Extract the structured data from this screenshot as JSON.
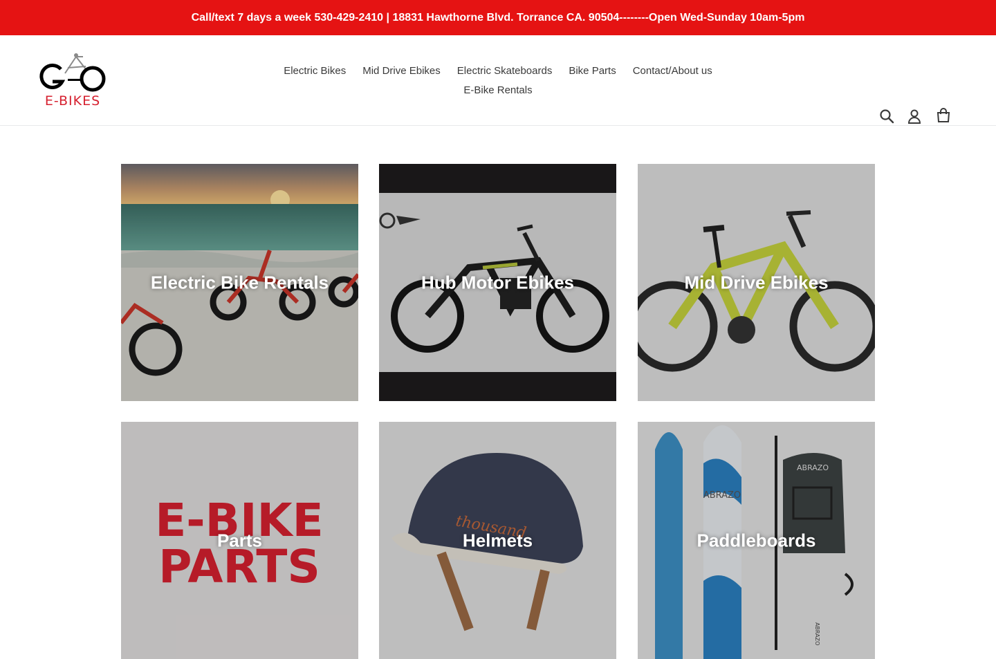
{
  "announcement": "Call/text 7 days a week 530-429-2410 | 18831 Hawthorne Blvd. Torrance CA. 90504--------Open Wed-Sunday 10am-5pm",
  "logo": {
    "top_text": "GO",
    "bottom_text": "E-BIKES"
  },
  "nav": {
    "items": [
      "Electric Bikes",
      "Mid Drive Ebikes",
      "Electric Skateboards",
      "Bike Parts",
      "Contact/About us",
      "E-Bike Rentals"
    ]
  },
  "header_icons": [
    "search-icon",
    "account-icon",
    "cart-icon"
  ],
  "collections": [
    {
      "label": "Electric Bike Rentals"
    },
    {
      "label": "Hub Motor Ebikes"
    },
    {
      "label": "Mid Drive Ebikes"
    },
    {
      "label": "Parts",
      "image_text": [
        "E-BIKE",
        "PARTS"
      ]
    },
    {
      "label": "Helmets",
      "image_text": "thousand"
    },
    {
      "label": "Paddleboards",
      "image_text": [
        "ABRAZO",
        "ABRAZO",
        "ABRAZO"
      ]
    }
  ],
  "colors": {
    "accent": "#e51313",
    "text": "#3a3a3a",
    "brand_red": "#d6202f"
  }
}
